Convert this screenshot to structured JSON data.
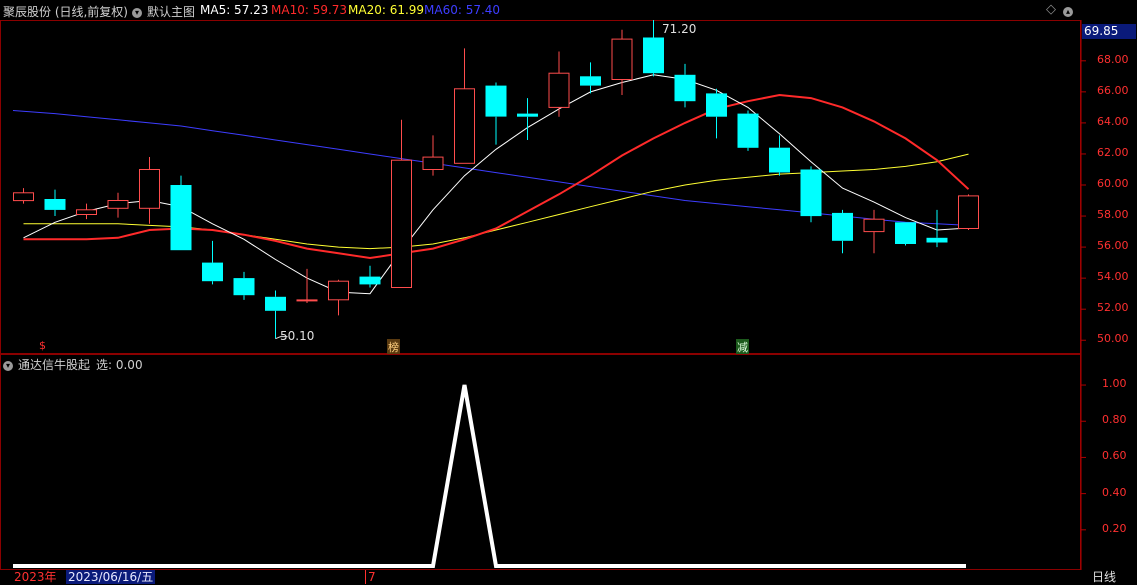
{
  "header": {
    "stock_title": "聚辰股份 (日线,前复权)",
    "main_chart_label": "默认主图",
    "ma5": "MA5: 57.23",
    "ma10": "MA10: 59.73",
    "ma20": "MA20: 61.99",
    "ma60": "MA60: 57.40",
    "colors": {
      "ma5": "#ffffff",
      "ma10": "#ff2a2a",
      "ma20": "#ffff33",
      "ma60": "#3d3dff"
    }
  },
  "price_axis": {
    "current_price": "69.85",
    "ticks": [
      "68.00",
      "66.00",
      "64.00",
      "62.00",
      "60.00",
      "58.00",
      "56.00",
      "54.00",
      "52.00",
      "50.00"
    ]
  },
  "annotations": {
    "high_label": "71.20",
    "low_label": "50.10",
    "marker_s": "$",
    "marker_bang": "榜",
    "marker_jian": "减"
  },
  "indicator": {
    "title": "通达信牛股起",
    "select_label": "选: 0.00",
    "ticks": [
      "1.00",
      "0.80",
      "0.60",
      "0.40",
      "0.20"
    ]
  },
  "footer": {
    "year": "2023年",
    "cursor_date": "2023/06/16/五",
    "month_marker": "7",
    "period": "日线"
  },
  "chart_data": {
    "type": "candlestick",
    "ylim": [
      49.5,
      70.5
    ],
    "candles": [
      {
        "o": 59.0,
        "c": 59.5,
        "h": 59.8,
        "l": 58.8
      },
      {
        "o": 59.1,
        "c": 58.4,
        "h": 59.7,
        "l": 58.0
      },
      {
        "o": 58.1,
        "c": 58.4,
        "h": 58.8,
        "l": 57.8
      },
      {
        "o": 58.5,
        "c": 59.0,
        "h": 59.5,
        "l": 57.9
      },
      {
        "o": 58.5,
        "c": 61.0,
        "h": 61.8,
        "l": 57.5
      },
      {
        "o": 60.0,
        "c": 55.8,
        "h": 60.6,
        "l": 55.8
      },
      {
        "o": 55.0,
        "c": 53.8,
        "h": 56.4,
        "l": 53.6
      },
      {
        "o": 54.0,
        "c": 52.9,
        "h": 54.4,
        "l": 52.6
      },
      {
        "o": 52.8,
        "c": 51.9,
        "h": 53.2,
        "l": 50.1
      },
      {
        "o": 52.6,
        "c": 52.6,
        "h": 54.6,
        "l": 52.4
      },
      {
        "o": 52.6,
        "c": 53.8,
        "h": 53.9,
        "l": 51.6
      },
      {
        "o": 54.1,
        "c": 53.6,
        "h": 54.8,
        "l": 53.4
      },
      {
        "o": 53.4,
        "c": 61.6,
        "h": 64.2,
        "l": 53.4
      },
      {
        "o": 61.0,
        "c": 61.8,
        "h": 63.2,
        "l": 60.6
      },
      {
        "o": 61.4,
        "c": 66.2,
        "h": 68.8,
        "l": 61.4
      },
      {
        "o": 66.4,
        "c": 64.4,
        "h": 66.6,
        "l": 62.6
      },
      {
        "o": 64.6,
        "c": 64.4,
        "h": 65.6,
        "l": 62.9
      },
      {
        "o": 65.0,
        "c": 67.2,
        "h": 68.6,
        "l": 64.4
      },
      {
        "o": 67.0,
        "c": 66.4,
        "h": 67.9,
        "l": 65.9
      },
      {
        "o": 66.8,
        "c": 69.4,
        "h": 70.0,
        "l": 65.8
      },
      {
        "o": 69.5,
        "c": 67.2,
        "h": 71.2,
        "l": 67.0
      },
      {
        "o": 67.1,
        "c": 65.4,
        "h": 67.8,
        "l": 65.0
      },
      {
        "o": 65.9,
        "c": 64.4,
        "h": 66.2,
        "l": 63.0
      },
      {
        "o": 64.6,
        "c": 62.4,
        "h": 64.8,
        "l": 62.2
      },
      {
        "o": 62.4,
        "c": 60.8,
        "h": 63.2,
        "l": 60.6
      },
      {
        "o": 61.0,
        "c": 58.0,
        "h": 61.2,
        "l": 57.6
      },
      {
        "o": 58.2,
        "c": 56.4,
        "h": 58.4,
        "l": 55.6
      },
      {
        "o": 57.0,
        "c": 57.8,
        "h": 58.4,
        "l": 55.6
      },
      {
        "o": 57.6,
        "c": 56.2,
        "h": 57.6,
        "l": 56.1
      },
      {
        "o": 56.6,
        "c": 56.3,
        "h": 58.4,
        "l": 56.0
      },
      {
        "o": 57.2,
        "c": 59.3,
        "h": 59.4,
        "l": 57.1
      }
    ],
    "ma5": [
      56.6,
      57.6,
      58.3,
      58.8,
      59.0,
      58.6,
      57.5,
      56.5,
      55.2,
      54.0,
      53.1,
      53.0,
      55.8,
      58.4,
      60.6,
      62.3,
      63.7,
      64.9,
      66.0,
      66.6,
      67.1,
      66.8,
      66.1,
      65.0,
      63.3,
      61.5,
      59.8,
      58.9,
      57.9,
      57.1,
      57.23
    ],
    "ma10": [
      56.5,
      56.5,
      56.5,
      56.6,
      57.1,
      57.2,
      57.1,
      56.8,
      56.4,
      55.9,
      55.6,
      55.3,
      55.6,
      55.9,
      56.5,
      57.2,
      58.3,
      59.4,
      60.6,
      61.9,
      63.0,
      64.0,
      64.9,
      65.4,
      65.8,
      65.6,
      65.0,
      64.1,
      63.0,
      61.6,
      59.73
    ],
    "ma20": [
      57.5,
      57.5,
      57.5,
      57.5,
      57.4,
      57.3,
      57.1,
      56.8,
      56.5,
      56.2,
      56.0,
      55.9,
      56.0,
      56.2,
      56.6,
      57.1,
      57.6,
      58.1,
      58.6,
      59.1,
      59.6,
      60.0,
      60.3,
      60.5,
      60.7,
      60.8,
      60.9,
      61.0,
      61.2,
      61.5,
      61.99
    ],
    "ma60": [
      64.8,
      64.6,
      64.4,
      64.2,
      64.0,
      63.8,
      63.5,
      63.2,
      62.9,
      62.6,
      62.3,
      62.0,
      61.7,
      61.4,
      61.1,
      60.8,
      60.5,
      60.2,
      59.9,
      59.6,
      59.3,
      59.0,
      58.8,
      58.6,
      58.4,
      58.2,
      58.0,
      57.8,
      57.6,
      57.5,
      57.4
    ],
    "indicator_values": [
      0,
      0,
      0,
      0,
      0,
      0,
      0,
      0,
      0,
      0,
      0,
      0,
      0,
      0,
      1,
      0,
      0,
      0,
      0,
      0,
      0,
      0,
      0,
      0,
      0,
      0,
      0,
      0,
      0,
      0,
      0
    ],
    "indicator_ylim": [
      0,
      1.05
    ]
  }
}
